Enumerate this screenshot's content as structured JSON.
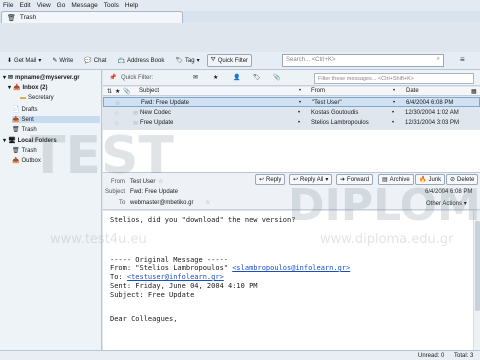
{
  "window": {
    "tab_title": "Trash"
  },
  "menu": [
    "File",
    "Edit",
    "View",
    "Go",
    "Message",
    "Tools",
    "Help"
  ],
  "toolbar": {
    "get_mail": "Get Mail",
    "write": "Write",
    "chat": "Chat",
    "address_book": "Address Book",
    "tag": "Tag",
    "quick_filter": "Quick Filter",
    "search_placeholder": "Search... <Ctrl+K>"
  },
  "folders": {
    "account": "mpname@myserver.gr",
    "inbox": "Inbox (2)",
    "secretary": "Secretary",
    "drafts": "Drafts",
    "sent": "Sent",
    "trash": "Trash",
    "local_folders": "Local Folders",
    "local_trash": "Trash",
    "outbox": "Outbox"
  },
  "filterbar": {
    "label": "Quick Filter:",
    "placeholder": "Filter these messages... <Ctrl+Shift+K>"
  },
  "columns": {
    "subject": "Subject",
    "from": "From",
    "date": "Date"
  },
  "messages": [
    {
      "subject": "Fwd: Free Update",
      "from": "\"Test User\"",
      "date": "6/4/2004 6:08 PM"
    },
    {
      "subject": "New Codec",
      "from": "Kostas Goutoudis",
      "date": "12/30/2004 1:02 AM"
    },
    {
      "subject": "Free Update",
      "from": "Stelios Lambropoulos",
      "date": "12/31/2004 3:03 PM"
    }
  ],
  "reader": {
    "actions": {
      "reply": "Reply",
      "reply_all": "Reply All",
      "forward": "Forward",
      "archive": "Archive",
      "junk": "Junk",
      "delete": "Delete",
      "other_actions": "Other Actions"
    },
    "from_label": "From",
    "from_value": "Test User",
    "subject_label": "Subject",
    "subject_value": "Fwd: Free Update",
    "to_label": "To",
    "to_value": "webmaster@mbetiko.gr",
    "date": "6/4/2004 6:08 PM",
    "body": {
      "line1": "Stelios, did you \"download\" the new version?",
      "sep": "----- Original Message -----",
      "from_prefix": "From: \"Stelios Lambropoulos\" ",
      "from_email": "<slambropoulos@infolearn.gr>",
      "to_prefix": "To: ",
      "to_email": "<testuser@infolearn.gr>",
      "sent": "Sent: Friday, June 04, 2004 4:10 PM",
      "subject": "Subject: Free Update",
      "greeting": "Dear Colleagues,"
    }
  },
  "status": {
    "unread": "Unread: 0",
    "total": "Total: 3"
  },
  "watermark": {
    "test": "TEST",
    "diploma": "DIPLOMA",
    "url1": "www.test4u.eu",
    "url2": "www.diploma.edu.gr"
  },
  "colors": {
    "accent": "#1a4fc4",
    "selection": "#cfe1f3"
  }
}
